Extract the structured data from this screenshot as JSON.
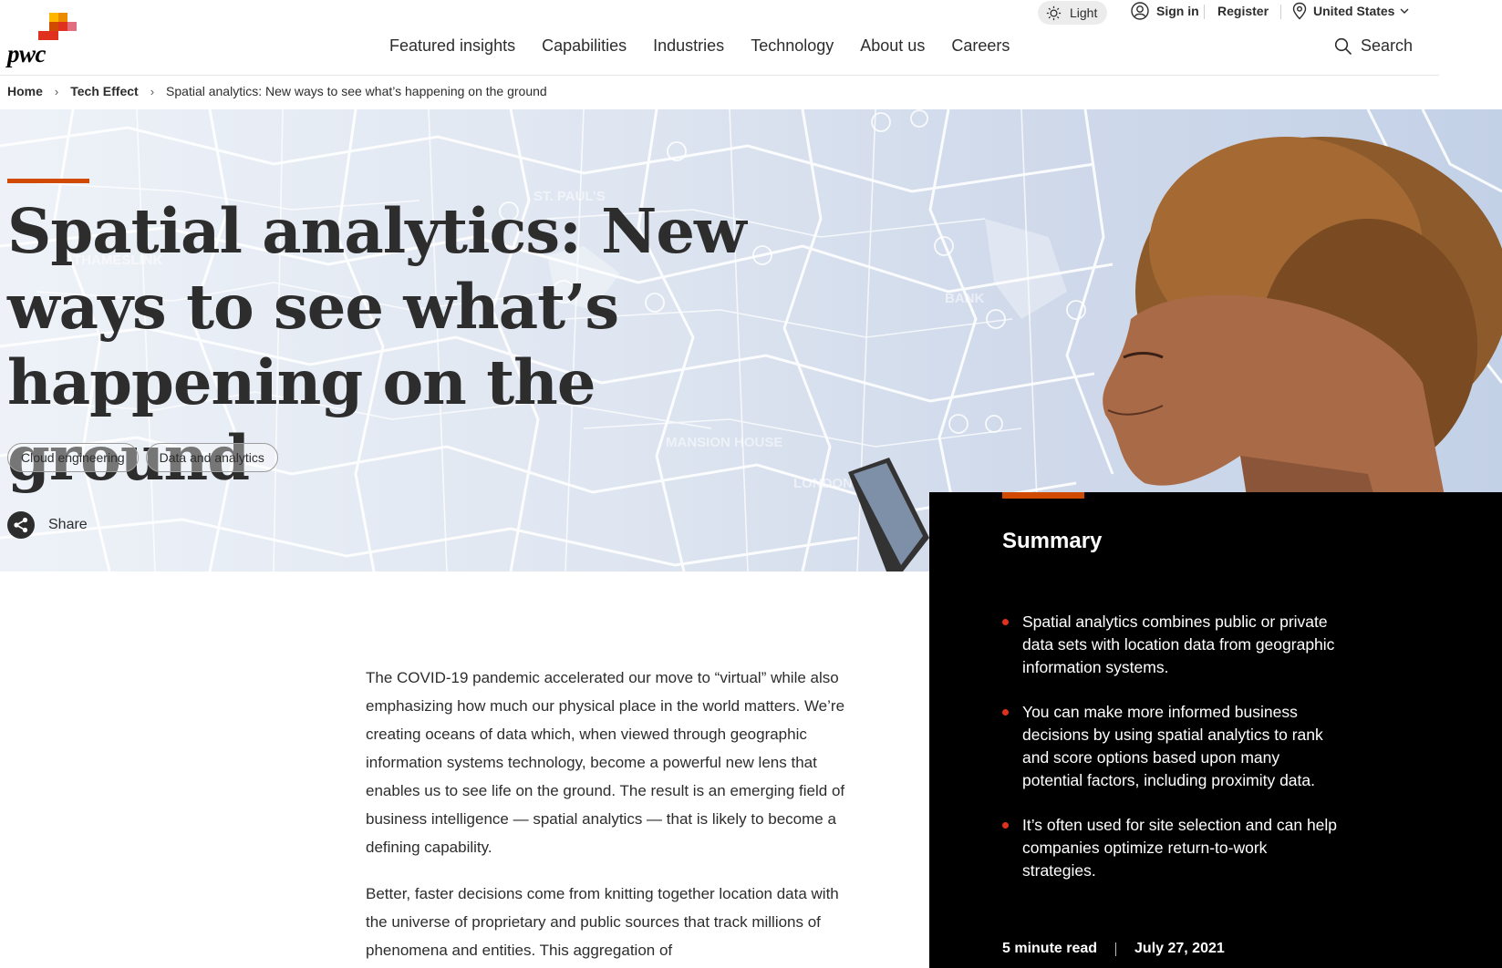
{
  "brand": {
    "name": "pwc",
    "accent": "#d04a02"
  },
  "utility": {
    "theme_label": "Light",
    "signin_label": "Sign in",
    "register_label": "Register",
    "country_label": "United States"
  },
  "nav": {
    "items": [
      "Featured insights",
      "Capabilities",
      "Industries",
      "Technology",
      "About us",
      "Careers"
    ],
    "search_label": "Search"
  },
  "breadcrumb": {
    "home": "Home",
    "section": "Tech Effect",
    "current": "Spatial analytics: New ways to see what’s happening on the ground"
  },
  "hero": {
    "title_lines": [
      "Spatial analytics: New",
      "ways to see what’s",
      "happening on the ground"
    ],
    "tags": [
      "Cloud engineering",
      "Data and analytics"
    ],
    "share_label": "Share"
  },
  "summary": {
    "heading": "Summary",
    "bullets": [
      "Spatial analytics combines public or private data sets with location data from geographic information systems.",
      "You can make more informed business decisions by using spatial analytics to rank and score options based upon many potential factors, including proximity data.",
      "It’s often used for site selection and can help companies optimize return-to-work strategies."
    ],
    "read_time": "5 minute read",
    "date": "July 27, 2021"
  },
  "article": {
    "paragraphs": [
      "The COVID-19 pandemic accelerated our move to “virtual” while also emphasizing how much our physical place in the world matters. We’re creating oceans of data which, when viewed through geographic information systems technology, become a powerful new lens that enables us to see life on the ground. The result is an emerging field of business intelligence — spatial analytics — that is likely to become a defining capability.",
      "Better, faster decisions come from knitting together location data with the universe of proprietary and public sources that track millions of phenomena and entities. This aggregation of"
    ]
  },
  "icons": [
    "sun-icon",
    "user-icon",
    "location-pin-icon",
    "chevron-down-icon",
    "search-icon",
    "chevron-right-icon",
    "share-icon"
  ]
}
